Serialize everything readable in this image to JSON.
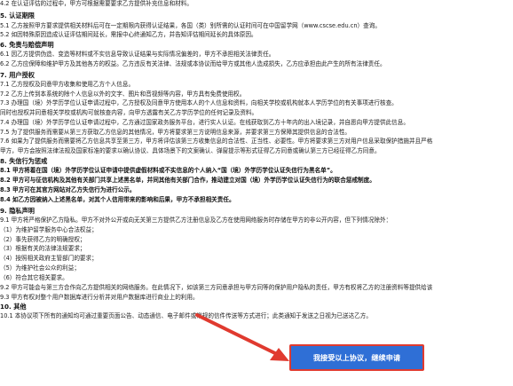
{
  "agreement": {
    "lines": [
      {
        "text": "4.2 在认证评估的过程中，甲方可根据需要要求乙方提供补充信息和材料。",
        "style": "n"
      },
      {
        "text": "5. 认证期限",
        "style": "h"
      },
      {
        "text": "5.1 乙方按照甲方要求提供相关材料后可在一定期限内获得认证结果，各国（类）别所需的认证时间可在中国留学网（www.cscse.edu.cn）查询。",
        "style": "n"
      },
      {
        "text": "5.2 如因特殊原因造成认证评估期间延长，需报中心终通知乙方，并告知评估期间延长的具体原因。",
        "style": "n"
      },
      {
        "text": "6. 免责与赔偿声明",
        "style": "h"
      },
      {
        "text": "6.1 因乙方提供伪造、变造等材料或不实信息导致认证结果与实际情况偏差的，甲方不承担相关法律责任。",
        "style": "n"
      },
      {
        "text": "6.2 乙方应保障和维护甲方及其他各方的权益。乙方违反有关法律、法规或本协议而给甲方或其他人造成损失，乙方应承担由此产生的所有法律责任。",
        "style": "n"
      },
      {
        "text": "7. 用户授权",
        "style": "h"
      },
      {
        "text": "7.1 乙方授权及同意甲方收集和使用乙方个人信息。",
        "style": "n"
      },
      {
        "text": "7.2 乙方上传到本系统的除个人信息以外的文字、图片和音视频等内容，甲方具有免费使用权。",
        "style": "n"
      },
      {
        "text": "7.3 办理国（境）外学历学位认证申请过程中，乙方授权及同意甲方使用本人的个人信息和资料，向相关学校或机构就本人学历学位的有关事项进行核查。",
        "style": "n"
      },
      {
        "text": "       同时也授权并同意相关学校或机构可就核查内容，向甲方透露有关乙方学历学位的任何记录及资料。",
        "style": "n"
      },
      {
        "text": "7.4 办理国（境）外学历学位认证申请过程中，乙方通过国家政务服务平台，进行实人认证。在线获取到乙方十年内的出入境记录，并自愿向甲方提供此信息。",
        "style": "n"
      },
      {
        "text": "7.5 为了提供服务而需要从第三方获取乙方信息的其他情况，甲方将要求第三方说明信息来源，并要求第三方保障其提供信息的合法性。",
        "style": "n"
      },
      {
        "text": "7.6 如果为了提供服务而需要将乙方信息共享至第三方，甲方将评估该第三方收集信息的合法性、正当性、必要性。甲方将要求第三方对用户信息采取保护措施并且严格",
        "style": "n"
      },
      {
        "text": "       甲方，甲方会按照法律法规及国家标准的要求以确认协议、具体场景下的文案确认、弹窗提示等形式征得乙方同意或确认第三方已经征得乙方同意。",
        "style": "n"
      },
      {
        "text": "8. 失信行为惩戒",
        "style": "h"
      },
      {
        "text": "8.1 甲方将着在国（境）外学历学位认证申请中提供虚假材料或不实信息的个人纳入“国（境）外学历学位认证失信行为黑名单”。",
        "style": "b"
      },
      {
        "text": "8.2 甲方可与征信机构及其他有关部门共享上述黑名单，并同其他有关部门合作，推动建立对国（境）外学历学位认证失信行为的联合惩戒制度。",
        "style": "b"
      },
      {
        "text": "8.3 甲方可在其官方网站对乙方失信行为进行公示。",
        "style": "b"
      },
      {
        "text": "8.4 如乙方因被纳入上述黑名单，对其个人信用带来的影响和后果，甲方不承担相关责任。",
        "style": "b"
      },
      {
        "text": "9. 隐私声明",
        "style": "h"
      },
      {
        "text": "9.1 甲方将严格保护乙方隐私。甲方不对外公开或向无关第三方提供乙方注册信息及乙方在使用网络服务时存储在甲方的非公开内容，但下列情况除外：",
        "style": "n"
      },
      {
        "text": "      （1）为维护留学服务中心合法权益；",
        "style": "n"
      },
      {
        "text": "      （2）事先获得乙方的明确授权；",
        "style": "n"
      },
      {
        "text": "      （3）根据有关的法律法规要求；",
        "style": "n"
      },
      {
        "text": "      （4）按照相关政府主管部门的要求；",
        "style": "n"
      },
      {
        "text": "      （5）为维护社会公众的利益；",
        "style": "n"
      },
      {
        "text": "      （6）符合其它相关要求。",
        "style": "n"
      },
      {
        "text": "9.2 甲方可能会与第三方合作向乙方提供相关的网络服务。在此情况下，如该第三方同意承担与甲方同等的保护用户隐私的责任，甲方有权将乙方的注册资料等提供给该",
        "style": "n"
      },
      {
        "text": "9.3 甲方有权对整个用户数据库进行分析并对用户数据库进行商业上的利用。",
        "style": "n"
      },
      {
        "text": "10. 其他",
        "style": "h"
      },
      {
        "text": "10.1 本协议项下所有的通知均可通过重要页面公告、动态通信、电子邮件或常规的信件传送等方式进行；此类通知于发送之日视为已送达乙方。",
        "style": "n"
      }
    ]
  },
  "confirm_button": {
    "label": "我接受以上协议，继续申请"
  },
  "colors": {
    "button_bg": "#2f6fd6",
    "highlight_border": "#e03a2f",
    "arrow": "#e03a2f"
  }
}
